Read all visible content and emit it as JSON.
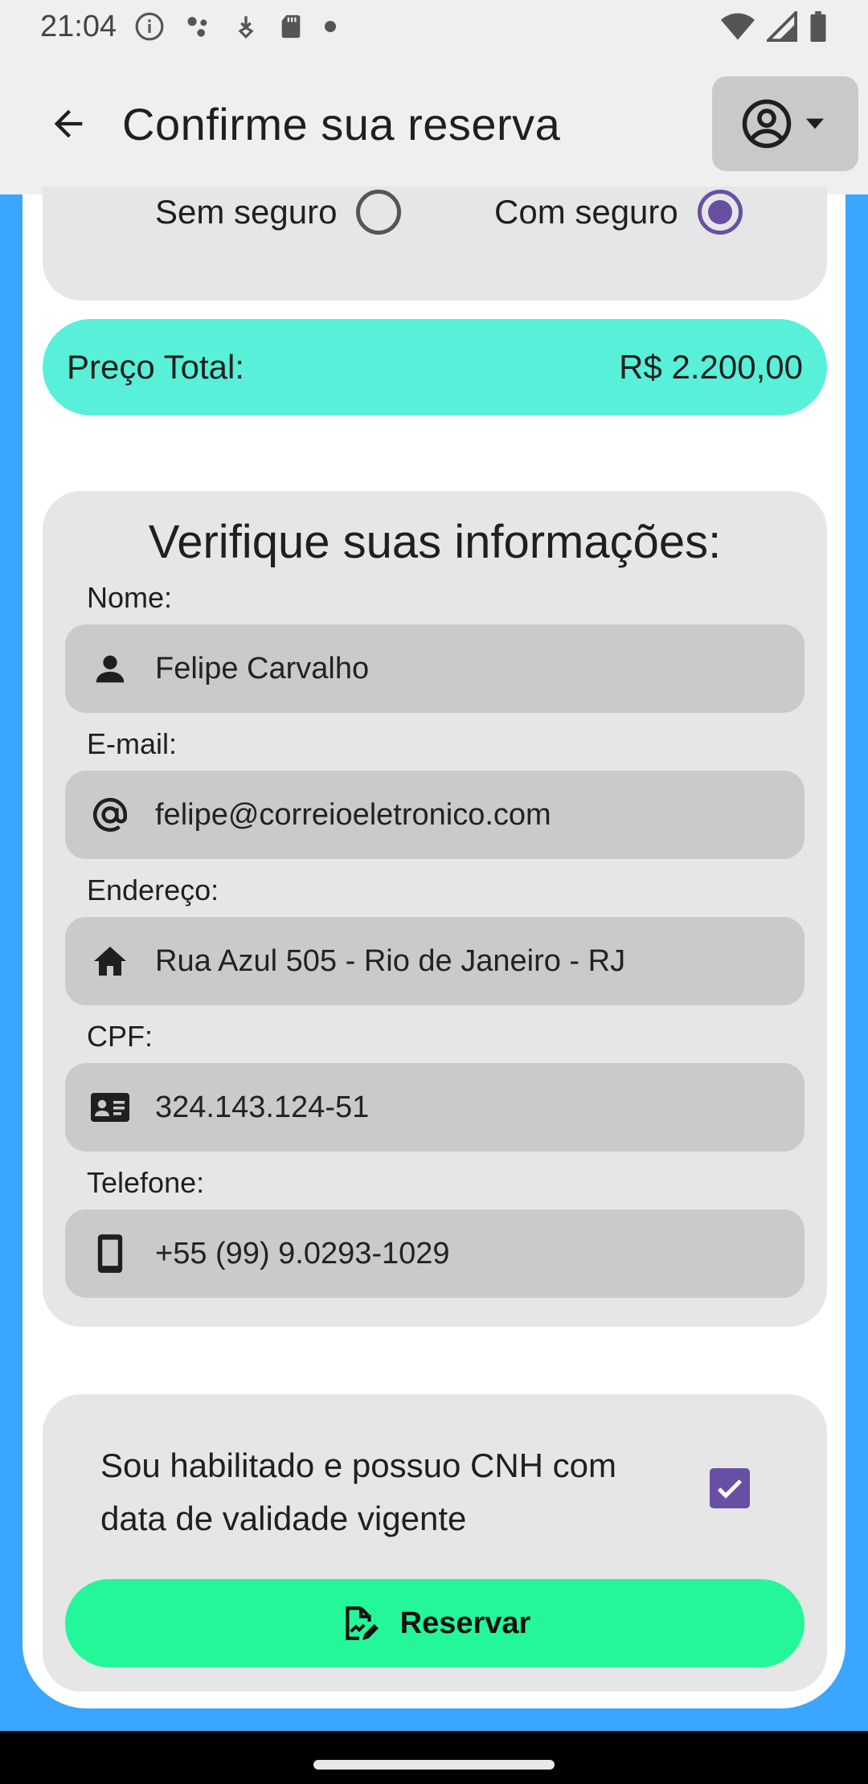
{
  "status_bar": {
    "time": "21:04",
    "icons": [
      "info-icon",
      "assistant-dots-icon",
      "download-icon",
      "sd-card-icon",
      "dot-icon",
      "wifi-icon",
      "signal-icon",
      "battery-icon"
    ]
  },
  "app_bar": {
    "title": "Confirme sua reserva",
    "back_icon": "arrow-back-icon",
    "account_icon": "account-circle-icon"
  },
  "insurance": {
    "options": [
      {
        "label": "Sem seguro",
        "selected": false
      },
      {
        "label": "Com seguro",
        "selected": true
      }
    ]
  },
  "price": {
    "label": "Preço Total:",
    "value": "R$ 2.200,00"
  },
  "info": {
    "title": "Verifique suas informações:",
    "fields": [
      {
        "label": "Nome:",
        "value": "Felipe Carvalho",
        "icon": "person-icon"
      },
      {
        "label": "E-mail:",
        "value": "felipe@correioeletronico.com",
        "icon": "at-sign-icon"
      },
      {
        "label": "Endereço:",
        "value": "Rua Azul 505 - Rio de Janeiro - RJ",
        "icon": "home-icon"
      },
      {
        "label": "CPF:",
        "value": "324.143.124-51",
        "icon": "id-card-icon"
      },
      {
        "label": "Telefone:",
        "value": "+55 (99) 9.0293-1029",
        "icon": "phone-icon"
      }
    ]
  },
  "confirm": {
    "cnh_text": "Sou habilitado e possuo CNH com data de validade vigente",
    "cnh_checked": true,
    "reserve_label": "Reservar",
    "reserve_icon": "edit-document-icon"
  },
  "colors": {
    "background_blue": "#3aa6ff",
    "price_teal": "#58f0d8",
    "reserve_green": "#24f79a",
    "accent_purple": "#6750a4",
    "panel_gray": "#e6e6e6",
    "field_gray": "#cacaca"
  }
}
